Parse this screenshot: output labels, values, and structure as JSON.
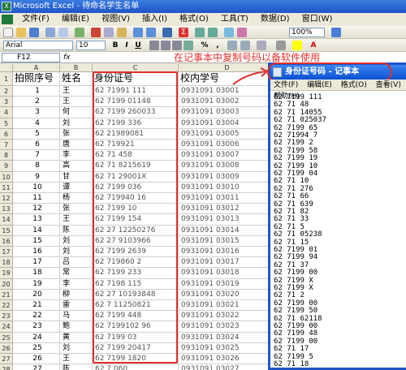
{
  "excel": {
    "title": "Microsoft Excel - 待命名学生名单",
    "menu": [
      "文件(F)",
      "编辑(E)",
      "视图(V)",
      "插入(I)",
      "格式(O)",
      "工具(T)",
      "数据(D)",
      "窗口(W)"
    ],
    "font_name": "Arial",
    "font_size": "10",
    "zoom": "100%",
    "name_box": "F12",
    "columns": [
      "A",
      "B",
      "C",
      "D"
    ],
    "headers": [
      "拍照序号",
      "姓名",
      "身份证号",
      "校内学号"
    ],
    "rows": [
      {
        "n": "1",
        "seq": "1",
        "name": "王",
        "id": "62  71991  111",
        "sid": "0931091  03001"
      },
      {
        "n": "2",
        "seq": "2",
        "name": "王",
        "id": "62  7199  01148",
        "sid": "0931091  03002"
      },
      {
        "n": "3",
        "seq": "3",
        "name": "何",
        "id": "62  7199  260033",
        "sid": "0931091  03003"
      },
      {
        "n": "4",
        "seq": "4",
        "name": "刘",
        "id": "62  7199  336",
        "sid": "0931091  03004"
      },
      {
        "n": "5",
        "seq": "5",
        "name": "张",
        "id": "62  21989081",
        "sid": "0931091  03005"
      },
      {
        "n": "6",
        "seq": "6",
        "name": "唐",
        "id": "62  719921",
        "sid": "0931091  03006"
      },
      {
        "n": "7",
        "seq": "7",
        "name": "李",
        "id": "62  71  458",
        "sid": "0931091  03007"
      },
      {
        "n": "8",
        "seq": "8",
        "name": "高",
        "id": "62  71  8215619",
        "sid": "0931091  03008"
      },
      {
        "n": "9",
        "seq": "9",
        "name": "甘",
        "id": "62  71  29001X",
        "sid": "0931091  03009"
      },
      {
        "n": "10",
        "seq": "10",
        "name": "谭",
        "id": "62  7199  036",
        "sid": "0931091  03010"
      },
      {
        "n": "11",
        "seq": "11",
        "name": "杨",
        "id": "62  719940  16",
        "sid": "0931091  03011"
      },
      {
        "n": "12",
        "seq": "12",
        "name": "张",
        "id": "62  7199  10",
        "sid": "0931091  03012"
      },
      {
        "n": "13",
        "seq": "13",
        "name": "王",
        "id": "62  7199  154",
        "sid": "0931091  03013"
      },
      {
        "n": "14",
        "seq": "14",
        "name": "陈",
        "id": "62  27  12250276",
        "sid": "0931091  03014"
      },
      {
        "n": "15",
        "seq": "15",
        "name": "刘",
        "id": "62  27  9103966",
        "sid": "0931091  03015"
      },
      {
        "n": "16",
        "seq": "16",
        "name": "刘",
        "id": "62  7199  2639",
        "sid": "0931091  03016"
      },
      {
        "n": "17",
        "seq": "17",
        "name": "吕",
        "id": "62  719860  2",
        "sid": "0931091  03017"
      },
      {
        "n": "18",
        "seq": "18",
        "name": "常",
        "id": "62  7199  233",
        "sid": "0931091  03018"
      },
      {
        "n": "19",
        "seq": "19",
        "name": "李",
        "id": "62  7198  115",
        "sid": "0931091  03019"
      },
      {
        "n": "20",
        "seq": "20",
        "name": "柳",
        "id": "62  27  10193848",
        "sid": "0931091  03020"
      },
      {
        "n": "21",
        "seq": "21",
        "name": "雷",
        "id": "62  7  11250821",
        "sid": "0931091  03021"
      },
      {
        "n": "22",
        "seq": "22",
        "name": "马",
        "id": "62  7199  448",
        "sid": "0931091  03022"
      },
      {
        "n": "23",
        "seq": "23",
        "name": "鲍",
        "id": "62  7199102  96",
        "sid": "0931091  03023"
      },
      {
        "n": "24",
        "seq": "24",
        "name": "黄",
        "id": "62  7199  03",
        "sid": "0931091  03024"
      },
      {
        "n": "25",
        "seq": "25",
        "name": "刘",
        "id": "62  7199  20417",
        "sid": "0931091  03025"
      },
      {
        "n": "26",
        "seq": "26",
        "name": "王",
        "id": "62  7199  1820",
        "sid": "0931091  03026"
      },
      {
        "n": "27",
        "seq": "27",
        "name": "陈",
        "id": "62  7  060",
        "sid": "0931091  03027"
      }
    ]
  },
  "annotation": "在记事本中复制号码以备软件使用",
  "notepad": {
    "title": "身份证号码 - 记事本",
    "menu": [
      "文件(F)",
      "编辑(E)",
      "格式(O)",
      "查看(V)",
      "帮助(H)"
    ],
    "lines": [
      "62  7199  111",
      "62  71  48",
      "62  71  14055",
      "62  71  025037",
      "62  7199  65",
      "62  71994  7",
      "62  7199  2",
      "62  7199  58",
      "62  7199  19",
      "62  7199  10",
      "62  7199  04",
      "62  71  10",
      "62  71  276",
      "62  71  66",
      "62  71  639",
      "62  71  82",
      "62  71  33",
      "62  71  5",
      "62  71  05238",
      "62  71  15",
      "62  7199  01",
      "62  7199  94",
      "62  71  37",
      "62  7199  00",
      "62  7199  X",
      "62  7199  X",
      "62  71  2",
      "62  7199  00",
      "62  7199  50",
      "62  71  62118",
      "62  7199  00",
      "62  7199  48",
      "62  7199  00",
      "62  71  17",
      "62  7199  5",
      "62  71  18"
    ]
  },
  "colors": {
    "accent_red": "#e0302c",
    "title_blue": "#1f55c8"
  }
}
